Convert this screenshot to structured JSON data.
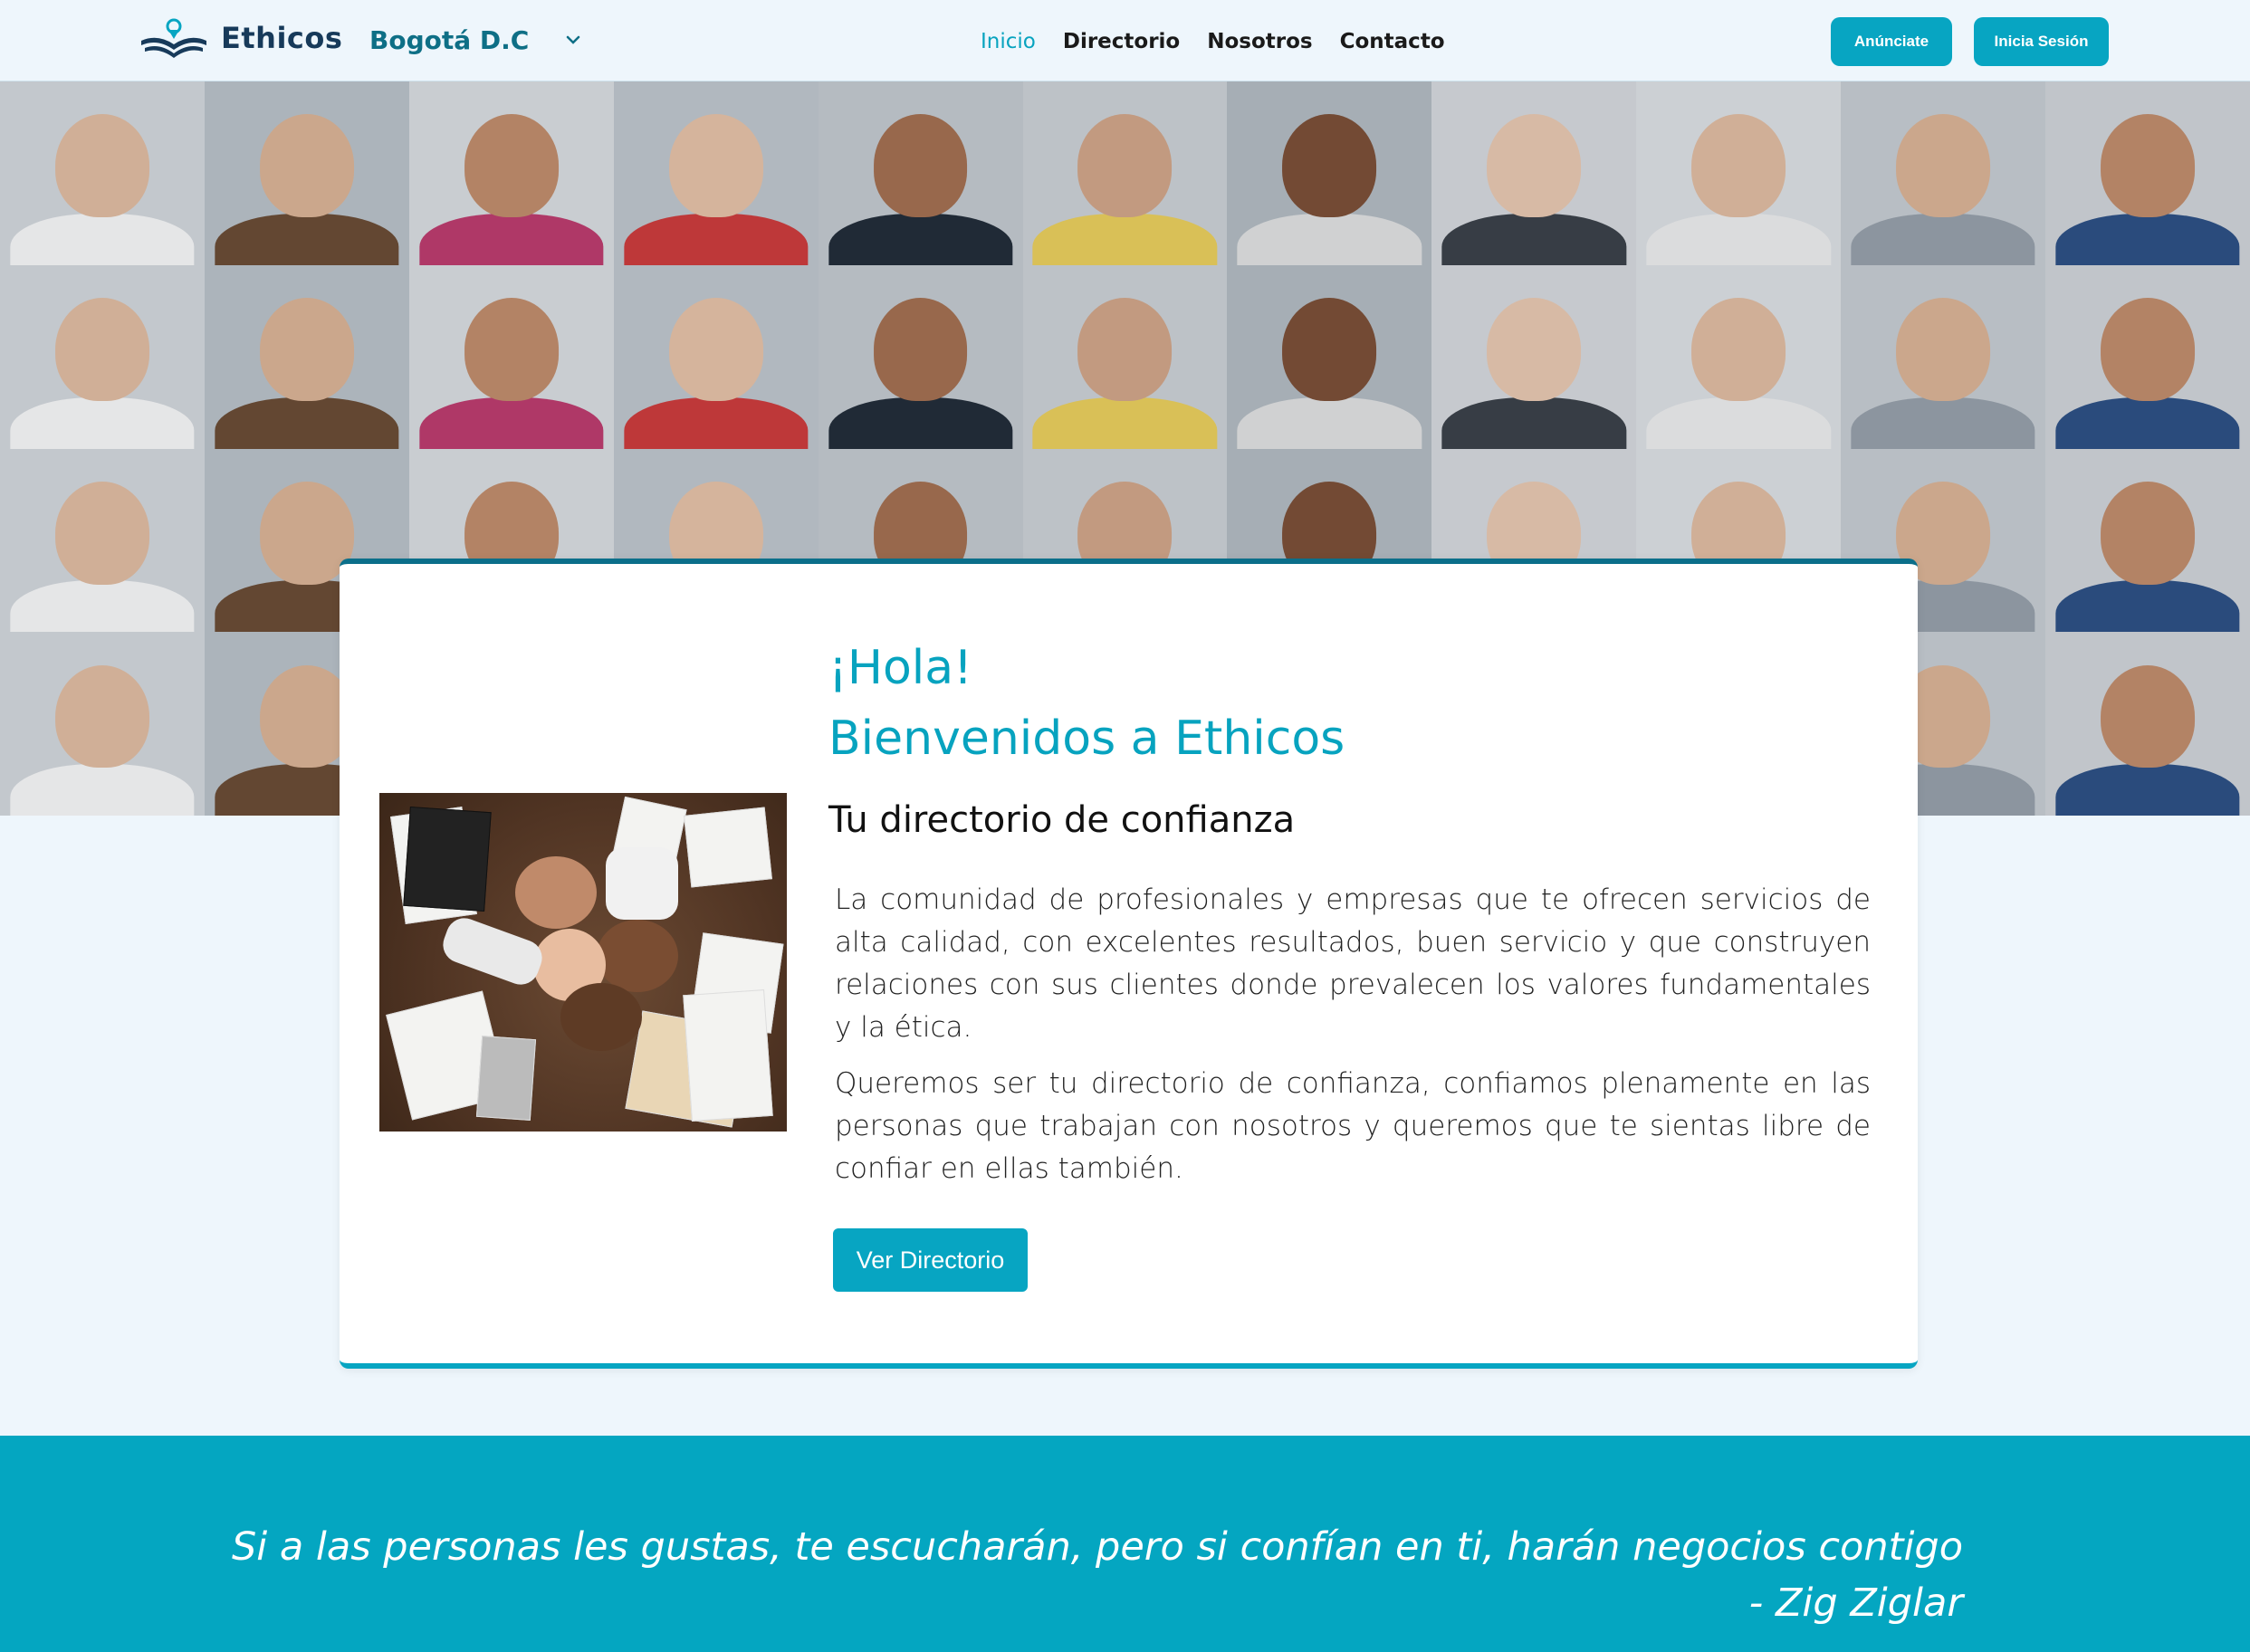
{
  "brand": {
    "name": "Ethicos",
    "accent": "#07a5c2",
    "dark": "#173a5a"
  },
  "location": {
    "selected": "Bogotá D.C",
    "icon": "chevron-down-icon"
  },
  "nav": {
    "links": [
      {
        "label": "Inicio",
        "active": true
      },
      {
        "label": "Directorio",
        "active": false
      },
      {
        "label": "Nosotros",
        "active": false
      },
      {
        "label": "Contacto",
        "active": false
      }
    ],
    "anunciate": "Anúnciate",
    "inicia_sesion": "Inicia Sesión"
  },
  "welcome": {
    "hola": "¡Hola!",
    "title": "Bienvenidos a Ethicos",
    "subtitle": "Tu directorio de confianza",
    "paragraph1": "La comunidad de profesionales y empresas que te ofrecen servicios de alta calidad, con excelentes resultados, buen servicio y que construyen relaciones con sus clientes donde prevalecen los valores fundamentales y la ética.",
    "paragraph2": "Queremos ser tu directorio de confianza, confiamos plenamente en las personas que trabajan con nosotros y queremos que te sientas libre de confiar en ellas también.",
    "button": "Ver Directorio"
  },
  "quote": {
    "text": "Si a las personas les gustas, te escucharán, pero si confían en ti, harán negocios contigo",
    "author": "- Zig Ziglar",
    "band_color": "#04a6c1"
  }
}
